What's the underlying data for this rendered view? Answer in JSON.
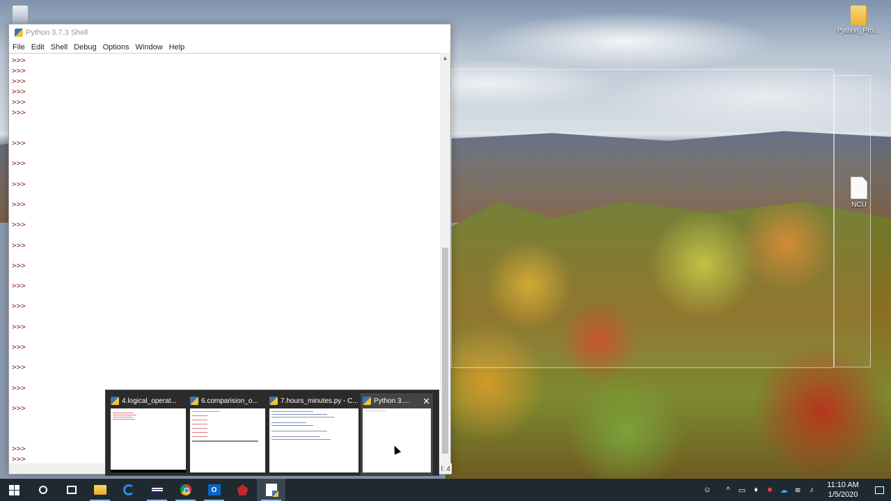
{
  "desktop": {
    "icons": [
      {
        "label": "Python_Pro..."
      },
      {
        "label": "NCU"
      }
    ]
  },
  "idle": {
    "title": "Python 3.7.3 Shell",
    "menu": [
      "File",
      "Edit",
      "Shell",
      "Debug",
      "Options",
      "Window",
      "Help"
    ],
    "prompt": ">>>",
    "status_fragment": "l: 4"
  },
  "thumbnails": [
    {
      "title": "4.logical_operat..."
    },
    {
      "title": "6.comparision_o..."
    },
    {
      "title": "7.hours_minutes.py - C..."
    },
    {
      "title": "Python 3...."
    }
  ],
  "taskbar": {
    "apps": [
      "start-icon",
      "cortana-icon",
      "task-view-icon",
      "file-explorer-icon",
      "edge-icon",
      "eclipse-icon",
      "chrome-icon",
      "outlook-icon",
      "bug-tool-icon",
      "idle-icon"
    ]
  },
  "tray": {
    "time": "11:10 AM",
    "date": "1/5/2020"
  }
}
